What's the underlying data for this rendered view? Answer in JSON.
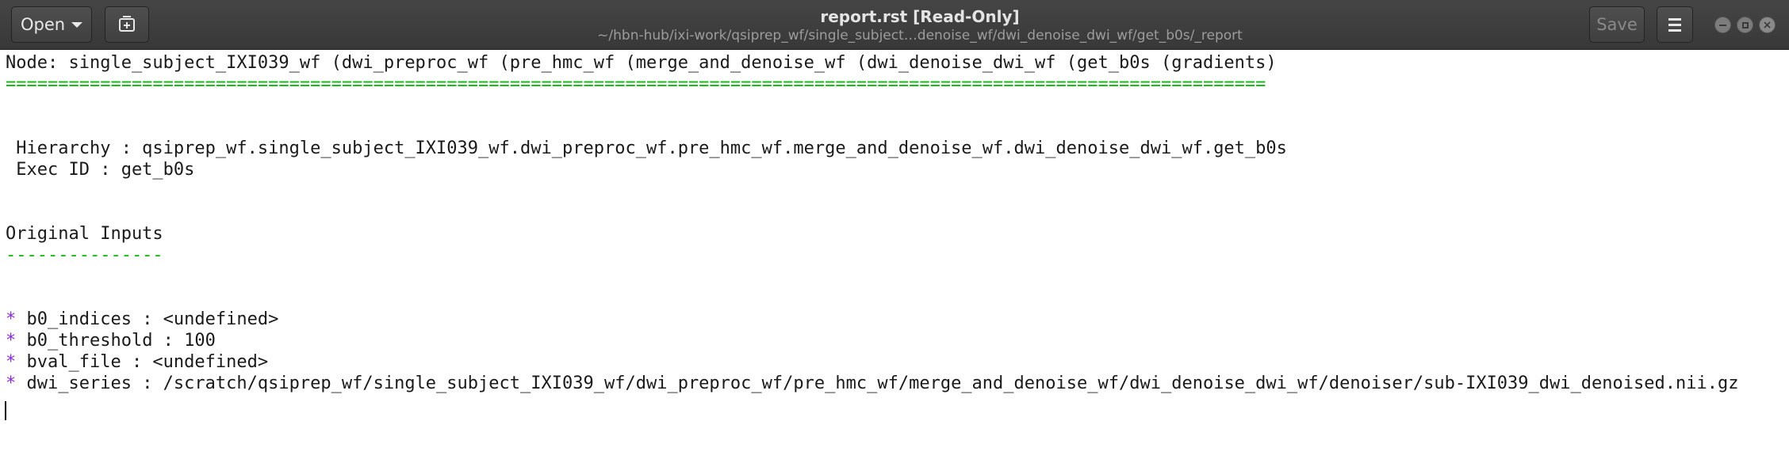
{
  "window": {
    "title": "report.rst [Read-Only]",
    "subtitle": "~/hbn-hub/ixi-work/qsiprep_wf/single_subject…denoise_wf/dwi_denoise_dwi_wf/get_b0s/_report"
  },
  "toolbar": {
    "open_label": "Open",
    "save_label": "Save"
  },
  "icons": {
    "open": "chevron-down-icon",
    "new_tab": "new-document-icon",
    "menu": "hamburger-menu-icon",
    "minimize": "minimize-icon",
    "maximize": "maximize-icon",
    "close": "close-icon"
  },
  "colors": {
    "header_bg": "#3c3c3c",
    "heading_underline": "#0fb70f",
    "bullet": "#8b2be2"
  },
  "document": {
    "node_line": "Node: single_subject_IXI039_wf (dwi_preproc_wf (pre_hmc_wf (merge_and_denoise_wf (dwi_denoise_dwi_wf (get_b0s (gradients)",
    "node_underline": "========================================================================================================================",
    "hierarchy": " Hierarchy : qsiprep_wf.single_subject_IXI039_wf.dwi_preproc_wf.pre_hmc_wf.merge_and_denoise_wf.dwi_denoise_dwi_wf.get_b0s",
    "exec_id": " Exec ID : get_b0s",
    "section_title": "Original Inputs",
    "section_underline": "---------------",
    "bullet_char": "*",
    "inputs": [
      " b0_indices : <undefined>",
      " b0_threshold : 100",
      " bval_file : <undefined>",
      " dwi_series : /scratch/qsiprep_wf/single_subject_IXI039_wf/dwi_preproc_wf/pre_hmc_wf/merge_and_denoise_wf/dwi_denoise_dwi_wf/denoiser/sub-IXI039_dwi_denoised.nii.gz"
    ]
  }
}
